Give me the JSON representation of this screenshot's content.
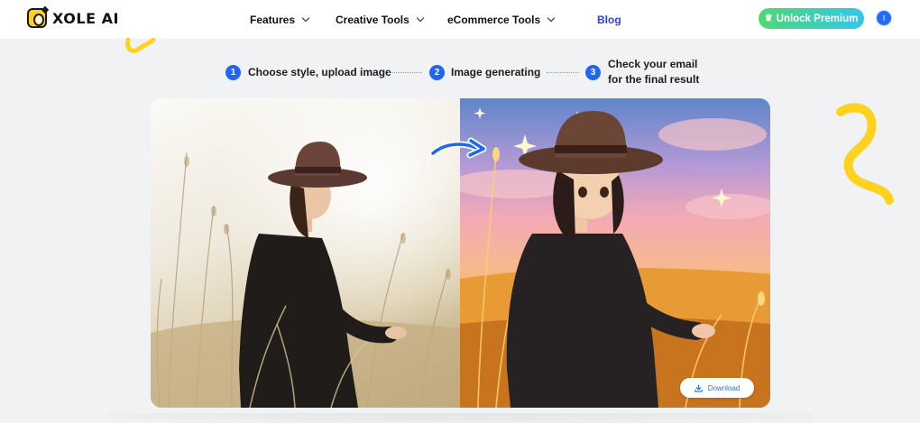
{
  "brand": {
    "name": "XOLE AI"
  },
  "nav": {
    "features": "Features",
    "creative_tools": "Creative Tools",
    "ecommerce_tools": "eCommerce Tools",
    "blog": "Blog"
  },
  "header": {
    "premium_label": "Unlock Premium",
    "avatar_initial": "I"
  },
  "steps": [
    {
      "number": "1",
      "label": "Choose style, upload image"
    },
    {
      "number": "2",
      "label": "Image generating"
    },
    {
      "number": "3",
      "label_line1": "Check your email",
      "label_line2": "for the final result"
    }
  ],
  "preview": {
    "download_label": "Download"
  },
  "colors": {
    "accent_blue": "#1f66f2",
    "blog_link": "#2b3ee6",
    "premium_start": "#4fd874",
    "premium_end": "#34c6e8",
    "squiggle_yellow": "#ffd21f"
  },
  "icons": {
    "premium": "crown-icon",
    "download": "download-icon",
    "transform": "arrow-right-icon"
  }
}
